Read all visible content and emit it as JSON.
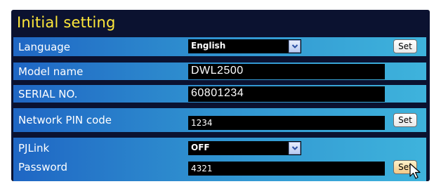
{
  "title": "Initial setting",
  "rows": {
    "language": {
      "label": "Language",
      "value": "English",
      "button": "Set"
    },
    "model": {
      "label": "Model name",
      "value": "DWL2500"
    },
    "serial": {
      "label": "SERIAL NO.",
      "value": "60801234"
    },
    "pin": {
      "label": "Network PIN code",
      "value": "1234",
      "button": "Set"
    },
    "pjlink": {
      "label": "PJLink",
      "value": "OFF"
    },
    "password": {
      "label": "Password",
      "value": "4321",
      "button": "Set"
    }
  },
  "icons": {
    "dropdown": "chevron-down-icon",
    "cursor": "mouse-pointer-icon"
  },
  "colors": {
    "title": "#ffe83a",
    "panel_bg": "#0b1230",
    "row_start": "#1f66c4",
    "row_end": "#3eb3dc",
    "field_bg": "#000000"
  }
}
